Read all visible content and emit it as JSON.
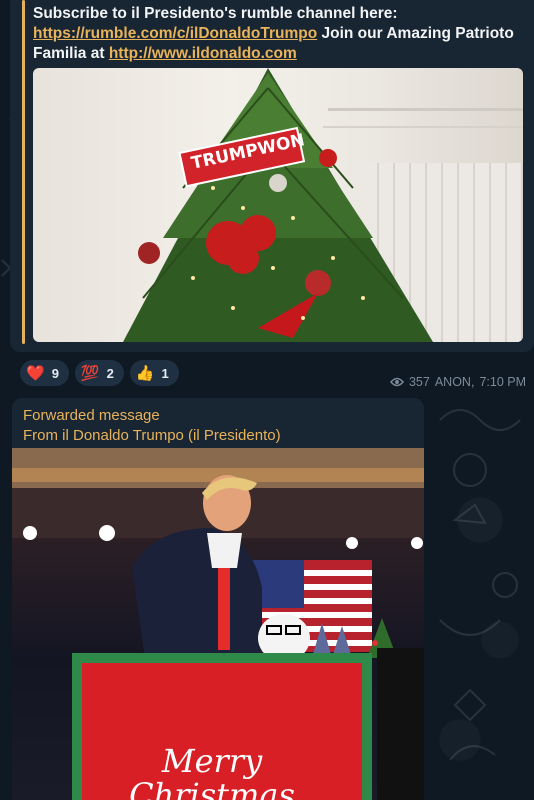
{
  "message1": {
    "text_before_link1": "Subscribe to il Presidento's rumble channel here: ",
    "link1": "https://rumble.com/c/ilDonaldoTrumpo",
    "text_between": " Join our Amazing Patrioto Familia at ",
    "link2": "http://www.ildonaldo.com",
    "image_sign_text": "TRUMPWON"
  },
  "reactions": [
    {
      "emoji": "❤️",
      "icon": "red-heart-icon",
      "count": "9"
    },
    {
      "emoji": "💯",
      "icon": "hundred-points-icon",
      "count": "2"
    },
    {
      "emoji": "👍",
      "icon": "thumbs-up-icon",
      "count": "1"
    }
  ],
  "meta": {
    "views": "357",
    "author": "ANON,",
    "time": "7:10 PM"
  },
  "message2": {
    "forwarded_label": "Forwarded message",
    "from_label": "From il Donaldo Trumpo (il Presidento)",
    "sign_line1": "Merry",
    "sign_line2": "Christmas"
  },
  "colors": {
    "bubble": "#182533",
    "accent": "#e8b35a",
    "background": "#0e1621"
  }
}
